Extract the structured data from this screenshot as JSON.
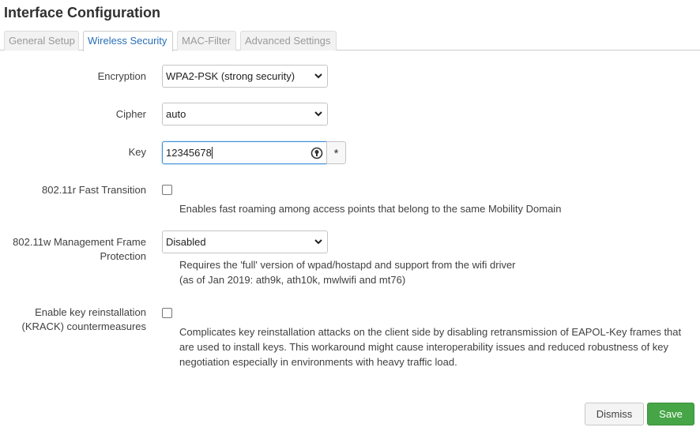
{
  "title": "Interface Configuration",
  "tabs": [
    {
      "label": "General Setup"
    },
    {
      "label": "Wireless Security"
    },
    {
      "label": "MAC-Filter"
    },
    {
      "label": "Advanced Settings"
    }
  ],
  "active_tab": "Wireless Security",
  "form": {
    "encryption": {
      "label": "Encryption",
      "value": "WPA2-PSK (strong security)"
    },
    "cipher": {
      "label": "Cipher",
      "value": "auto"
    },
    "key": {
      "label": "Key",
      "value": "12345678",
      "reveal_glyph": "*"
    },
    "fast_transition": {
      "label": "802.11r Fast Transition",
      "checked": false,
      "description": "Enables fast roaming among access points that belong to the same Mobility Domain"
    },
    "mgmt_frame_protection": {
      "label_line1": "802.11w Management Frame",
      "label_line2": "Protection",
      "value": "Disabled",
      "description_line1": "Requires the 'full' version of wpad/hostapd and support from the wifi driver",
      "description_line2": "(as of Jan 2019: ath9k, ath10k, mwlwifi and mt76)"
    },
    "krack": {
      "label_line1": "Enable key reinstallation",
      "label_line2": "(KRACK) countermeasures",
      "checked": false,
      "description_line1": "Complicates key reinstallation attacks on the client side by disabling retransmission of EAPOL-Key frames that",
      "description_line2": "are used to install keys. This workaround might cause interoperability issues and reduced robustness of key",
      "description_line3": "negotiation especially in environments with heavy traffic load."
    }
  },
  "buttons": {
    "dismiss": "Dismiss",
    "save": "Save"
  },
  "colors": {
    "accent": "#2a6fb7",
    "save": "#46a546",
    "focus": "#3c8fd7"
  }
}
